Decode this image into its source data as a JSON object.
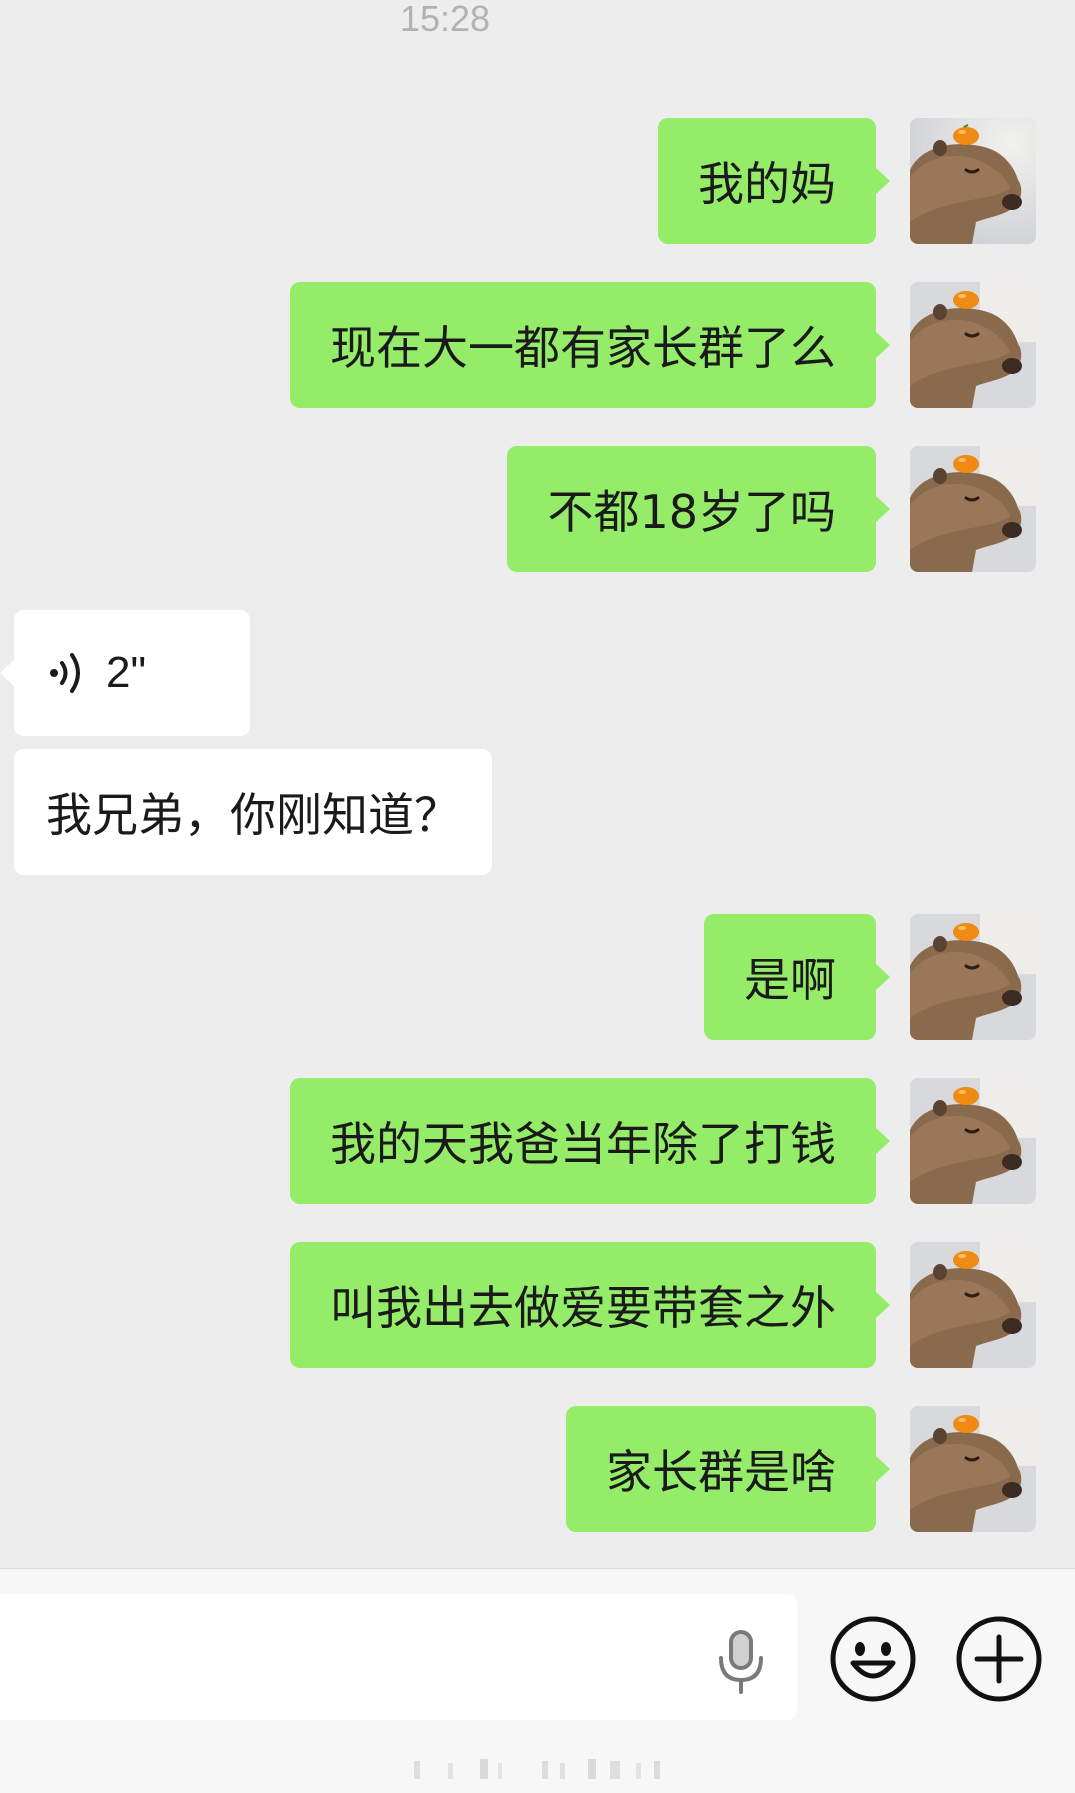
{
  "timestamp": "15:28",
  "messages": [
    {
      "side": "right",
      "type": "text",
      "text": "我的妈"
    },
    {
      "side": "right",
      "type": "text",
      "text": "现在大一都有家长群了么"
    },
    {
      "side": "right",
      "type": "text",
      "text": "不都18岁了吗"
    },
    {
      "side": "left",
      "type": "voice",
      "text": "2\""
    },
    {
      "side": "left",
      "type": "text",
      "text": "我兄弟，你刚知道？"
    },
    {
      "side": "right",
      "type": "text",
      "text": "是啊"
    },
    {
      "side": "right",
      "type": "text",
      "text": "我的天我爸当年除了打钱"
    },
    {
      "side": "right",
      "type": "text",
      "text": "叫我出去做爱要带套之外"
    },
    {
      "side": "right",
      "type": "text",
      "text": "家长群是啥"
    }
  ],
  "avatar_icon": "capybara-with-orange-avatar",
  "input_bar": {
    "mic_icon": "microphone-icon",
    "emoji_icon": "smiley-icon",
    "plus_icon": "plus-circle-icon"
  },
  "colors": {
    "sent_bubble": "#95ec69",
    "received_bubble": "#ffffff",
    "background": "#ededed"
  }
}
